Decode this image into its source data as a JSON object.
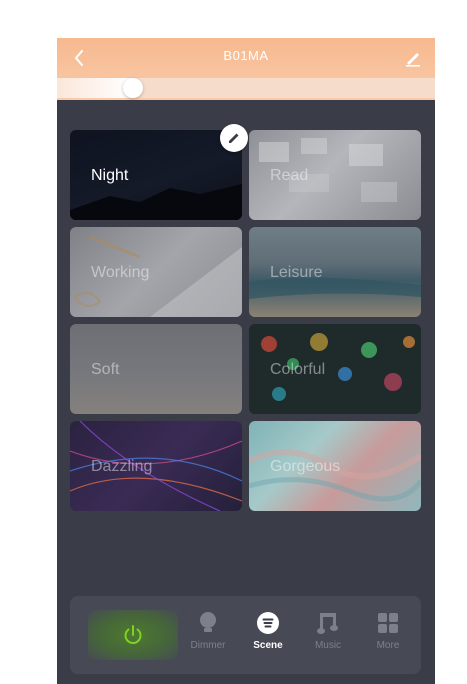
{
  "header": {
    "title": "B01MA"
  },
  "brightness": {
    "level": 0.2
  },
  "scenes": [
    {
      "name": "Night",
      "active": true
    },
    {
      "name": "Read",
      "active": false
    },
    {
      "name": "Working",
      "active": false
    },
    {
      "name": "Leisure",
      "active": false
    },
    {
      "name": "Soft",
      "active": false
    },
    {
      "name": "Colorful",
      "active": false
    },
    {
      "name": "Dazzling",
      "active": false
    },
    {
      "name": "Gorgeous",
      "active": false
    }
  ],
  "bottom_nav": {
    "dimmer": "Dimmer",
    "scene": "Scene",
    "music": "Music",
    "more": "More"
  },
  "colors": {
    "accent": "#f6b98f",
    "power_green": "#7ed321",
    "background": "#3a3d47"
  },
  "icons": {
    "back": "chevron-left-icon",
    "edit_name": "pencil-icon",
    "edit_scene": "pencil-icon",
    "power": "power-icon",
    "dimmer": "bulb-icon",
    "scene": "scene-list-icon",
    "music": "music-note-icon",
    "more": "grid-icon"
  }
}
